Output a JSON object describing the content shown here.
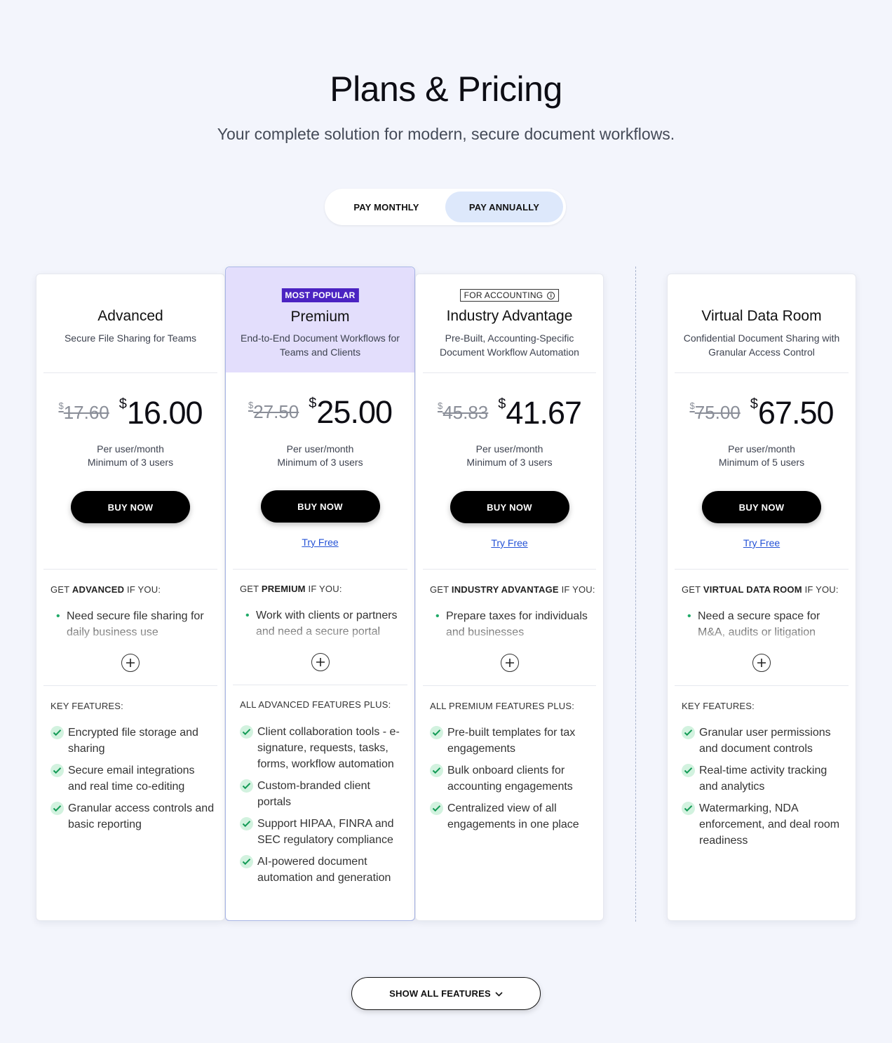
{
  "header": {
    "title": "Plans & Pricing",
    "subtitle": "Your complete solution for modern, secure document workflows."
  },
  "billing": {
    "monthly_label": "PAY MONTHLY",
    "annual_label": "PAY ANNUALLY",
    "selected": "annual"
  },
  "plans": [
    {
      "name": "Advanced",
      "tagline": "Secure File Sharing for Teams",
      "currency": "$",
      "old_price": "17.60",
      "price": "16.00",
      "note_line1": "Per user/month",
      "note_line2": "Minimum of 3 users",
      "buy_label": "BUY NOW",
      "get_label_prefix": "GET ",
      "get_label_plan": "ADVANCED",
      "get_label_suffix": " IF YOU:",
      "reason": "Need secure file sharing for daily business use",
      "features_label": "KEY FEATURES:",
      "features": [
        "Encrypted file storage and sharing",
        "Secure email integrations and real time co-editing",
        "Granular access controls and basic reporting"
      ]
    },
    {
      "badge": "MOST POPULAR",
      "name": "Premium",
      "tagline": "End-to-End Document Workflows for Teams and Clients",
      "currency": "$",
      "old_price": "27.50",
      "price": "25.00",
      "note_line1": "Per user/month",
      "note_line2": "Minimum of 3 users",
      "buy_label": "BUY NOW",
      "try_label": "Try Free",
      "get_label_prefix": "GET ",
      "get_label_plan": "PREMIUM",
      "get_label_suffix": " IF YOU:",
      "reason": "Work with clients or partners and need a secure portal",
      "features_label": "ALL ADVANCED FEATURES PLUS:",
      "features": [
        "Client collaboration tools - e-signature, requests, tasks, forms, workflow automation",
        "Custom-branded client portals",
        "Support HIPAA, FINRA and SEC regulatory compliance",
        "AI-powered document automation and generation"
      ]
    },
    {
      "badge": "FOR ACCOUNTING",
      "name": "Industry Advantage",
      "tagline": "Pre-Built, Accounting-Specific Document Workflow Automation",
      "currency": "$",
      "old_price": "45.83",
      "price": "41.67",
      "note_line1": "Per user/month",
      "note_line2": "Minimum of 3 users",
      "buy_label": "BUY NOW",
      "try_label": "Try Free",
      "get_label_prefix": "GET ",
      "get_label_plan": "INDUSTRY ADVANTAGE",
      "get_label_suffix": " IF YOU:",
      "reason": "Prepare taxes for individuals and businesses",
      "features_label": "ALL PREMIUM FEATURES PLUS:",
      "features": [
        "Pre-built templates for tax engagements",
        "Bulk onboard clients for accounting engagements",
        "Centralized view of all engagements in one place"
      ]
    },
    {
      "name": "Virtual Data Room",
      "tagline": "Confidential Document Sharing with Granular Access Control",
      "currency": "$",
      "old_price": "75.00",
      "price": "67.50",
      "note_line1": "Per user/month",
      "note_line2": "Minimum of 5 users",
      "buy_label": "BUY NOW",
      "try_label": "Try Free",
      "get_label_prefix": "GET ",
      "get_label_plan": "VIRTUAL DATA ROOM",
      "get_label_suffix": " IF YOU:",
      "reason": "Need a secure space for M&A, audits or litigation",
      "features_label": "KEY FEATURES:",
      "features": [
        "Granular user permissions and document controls",
        "Real-time activity tracking and analytics",
        "Watermarking, NDA enforcement, and deal room readiness"
      ]
    }
  ],
  "footer": {
    "show_all_label": "SHOW ALL FEATURES"
  },
  "colors": {
    "background": "#f3f5fc",
    "featured_header": "#e3defc",
    "badge_purple": "#4b23c2",
    "toggle_active": "#dde8fb",
    "link_blue": "#2553d6",
    "check_green": "#1faa68"
  }
}
